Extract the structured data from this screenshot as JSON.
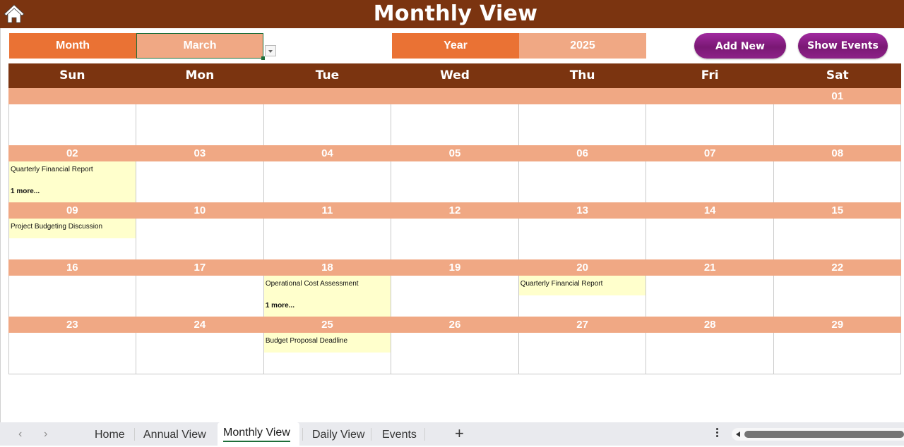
{
  "header": {
    "title": "Monthly View",
    "home_icon": "home-icon"
  },
  "controls": {
    "month_label": "Month",
    "month_value": "March",
    "year_label": "Year",
    "year_value": "2025",
    "add_new": "Add New",
    "show_events": "Show Events"
  },
  "colors": {
    "header_brown": "#7b3410",
    "label_orange": "#ea7234",
    "value_peach": "#f0a884",
    "event_yellow": "#ffffcc",
    "button_purple": "#8d2188"
  },
  "calendar": {
    "days": [
      "Sun",
      "Mon",
      "Tue",
      "Wed",
      "Thu",
      "Fri",
      "Sat"
    ],
    "weeks": [
      {
        "dates": [
          "",
          "",
          "",
          "",
          "",
          "",
          "01"
        ]
      },
      {
        "dates": [
          "02",
          "03",
          "04",
          "05",
          "06",
          "07",
          "08"
        ]
      },
      {
        "dates": [
          "09",
          "10",
          "11",
          "12",
          "13",
          "14",
          "15"
        ]
      },
      {
        "dates": [
          "16",
          "17",
          "18",
          "19",
          "20",
          "21",
          "22"
        ]
      },
      {
        "dates": [
          "23",
          "24",
          "25",
          "26",
          "27",
          "28",
          "29"
        ]
      }
    ],
    "events": [
      {
        "date": "02",
        "title": "Quarterly Financial Report",
        "more": "1 more..."
      },
      {
        "date": "09",
        "title": "Project Budgeting Discussion"
      },
      {
        "date": "18",
        "title": "Operational Cost Assessment",
        "more": "1 more..."
      },
      {
        "date": "20",
        "title": "Quarterly Financial Report"
      },
      {
        "date": "25",
        "title": "Budget Proposal Deadline"
      }
    ]
  },
  "sheet_tabs": {
    "tabs": [
      "Home",
      "Annual View",
      "Monthly View",
      "Daily View",
      "Events"
    ],
    "active": "Monthly View",
    "add_label": "+",
    "prev_label": "‹",
    "next_label": "›"
  }
}
